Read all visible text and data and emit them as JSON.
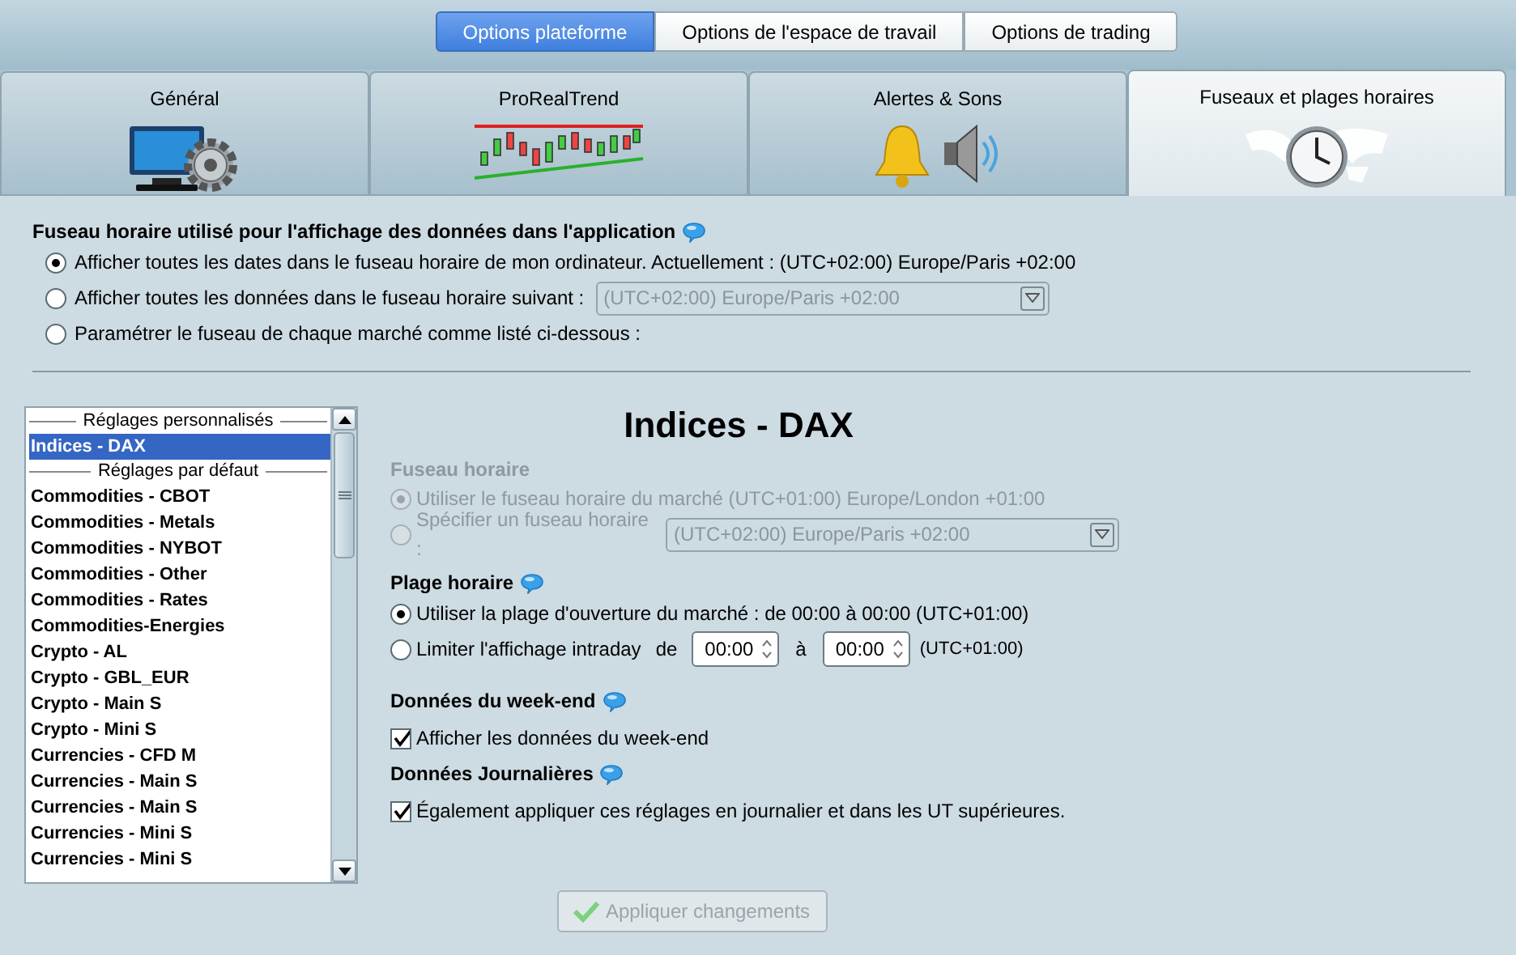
{
  "top_tabs": [
    {
      "label": "Options plateforme",
      "selected": true
    },
    {
      "label": "Options de l'espace de travail",
      "selected": false
    },
    {
      "label": "Options de trading",
      "selected": false
    }
  ],
  "category_tabs": [
    {
      "label": "Général",
      "selected": false
    },
    {
      "label": "ProRealTrend",
      "selected": false
    },
    {
      "label": "Alertes & Sons",
      "selected": false
    },
    {
      "label": "Fuseaux et plages horaires",
      "selected": true
    }
  ],
  "timezone_section": {
    "heading": "Fuseau horaire utilisé pour l'affichage des données dans l'application",
    "options": [
      {
        "kind": "text",
        "label": "Afficher toutes les dates dans le fuseau horaire de mon ordinateur. Actuellement : (UTC+02:00) Europe/Paris +02:00",
        "selected": true
      },
      {
        "kind": "dropdown",
        "label": "Afficher toutes les données dans le fuseau horaire suivant :",
        "selected": false,
        "value": "(UTC+02:00) Europe/Paris +02:00",
        "disabled": true
      },
      {
        "kind": "text",
        "label": "Paramétrer le fuseau de chaque marché comme listé ci-dessous :",
        "selected": false
      }
    ]
  },
  "market_list": {
    "items": [
      {
        "kind": "header",
        "label": "Réglages personnalisés"
      },
      {
        "kind": "item",
        "label": "Indices - DAX",
        "selected": true
      },
      {
        "kind": "header",
        "label": "Réglages par défaut"
      },
      {
        "kind": "item",
        "label": "Commodities - CBOT",
        "selected": false
      },
      {
        "kind": "item",
        "label": "Commodities - Metals",
        "selected": false
      },
      {
        "kind": "item",
        "label": "Commodities - NYBOT",
        "selected": false
      },
      {
        "kind": "item",
        "label": "Commodities - Other",
        "selected": false
      },
      {
        "kind": "item",
        "label": "Commodities - Rates",
        "selected": false
      },
      {
        "kind": "item",
        "label": "Commodities-Energies",
        "selected": false
      },
      {
        "kind": "item",
        "label": "Crypto - AL",
        "selected": false
      },
      {
        "kind": "item",
        "label": "Crypto - GBL_EUR",
        "selected": false
      },
      {
        "kind": "item",
        "label": "Crypto - Main S",
        "selected": false
      },
      {
        "kind": "item",
        "label": "Crypto - Mini S",
        "selected": false
      },
      {
        "kind": "item",
        "label": "Currencies - CFD M",
        "selected": false
      },
      {
        "kind": "item",
        "label": "Currencies - Main S",
        "selected": false
      },
      {
        "kind": "item",
        "label": "Currencies - Main S",
        "selected": false
      },
      {
        "kind": "item",
        "label": "Currencies - Mini S",
        "selected": false
      },
      {
        "kind": "item",
        "label": "Currencies - Mini S",
        "selected": false
      }
    ]
  },
  "detail": {
    "title": "Indices - DAX",
    "timezone": {
      "heading": "Fuseau horaire",
      "disabled": true,
      "options": [
        {
          "kind": "text",
          "label": "Utiliser le fuseau horaire du marché (UTC+01:00) Europe/London +01:00",
          "selected": true
        },
        {
          "kind": "dropdown",
          "label": "Spécifier un fuseau horaire :",
          "selected": false,
          "value": "(UTC+02:00) Europe/Paris +02:00"
        }
      ]
    },
    "time_range": {
      "heading": "Plage horaire",
      "options": [
        {
          "kind": "text",
          "label": "Utiliser la plage d'ouverture du marché : de 00:00 à 00:00  (UTC+01:00)",
          "selected": true
        },
        {
          "kind": "range",
          "label": "Limiter l'affichage intraday",
          "from_label": "de",
          "from": "00:00",
          "to_label": "à",
          "to": "00:00",
          "suffix": "(UTC+01:00)",
          "selected": false
        }
      ]
    },
    "weekend": {
      "heading": "Données du week-end",
      "checkbox": {
        "label": "Afficher les données du week-end",
        "checked": true
      }
    },
    "daily": {
      "heading": "Données Journalières",
      "checkbox": {
        "label": "Également appliquer ces réglages en journalier et dans les UT supérieures.",
        "checked": true
      }
    },
    "apply_button": {
      "label": "Appliquer changements",
      "disabled": true
    }
  }
}
